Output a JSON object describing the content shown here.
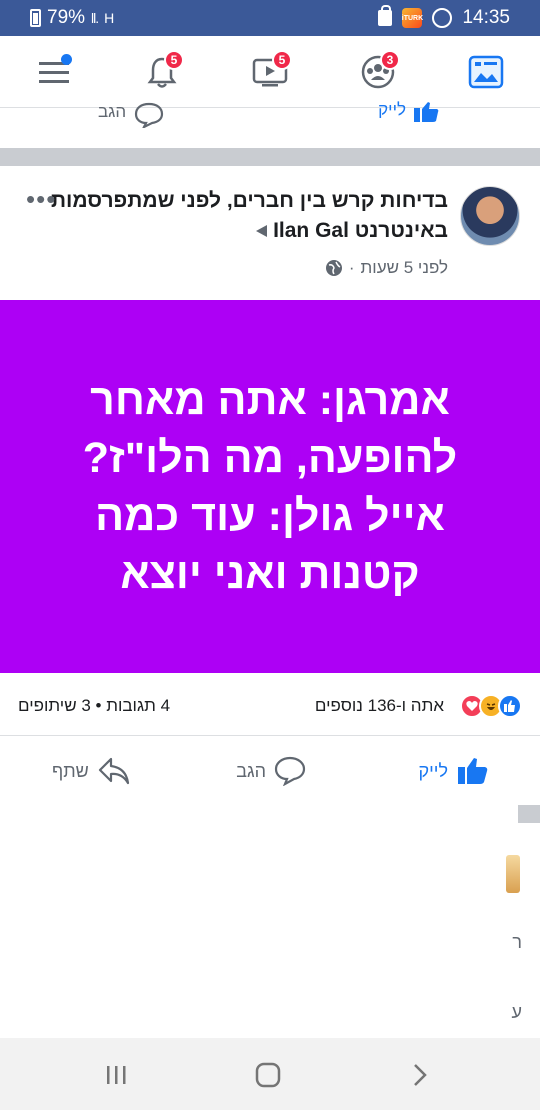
{
  "status_bar": {
    "battery": "79%",
    "signal": "ll.",
    "network": "H",
    "time": "14:35",
    "app_badge": "iTURK"
  },
  "nav": {
    "notifications_badge": "5",
    "watch_badge": "5",
    "groups_badge": "3",
    "accent": "#1877f2"
  },
  "prev_post": {
    "like_label": "לייק",
    "comment_label": "הגב"
  },
  "post": {
    "title": "בדיחות קרש בין חברים, לפני שמתפרסמות באינטרנט",
    "author": "Ilan Gal",
    "time": "לפני 5 שעות",
    "separator": "·",
    "image_text": "אמרגן: אתה מאחר להופעה, מה הלו\"ז? אייל גולן: עוד כמה קטנות ואני יוצא",
    "image_bg": "#ad00f5",
    "reactions_text": "אתה ו-136 נוספים",
    "comments_text": "4 תגובות • 3 שיתופים",
    "like_label": "לייק",
    "comment_label": "הגב",
    "share_label": "שתף"
  },
  "partial_right": {
    "char1": "ר",
    "char2": "ע"
  }
}
